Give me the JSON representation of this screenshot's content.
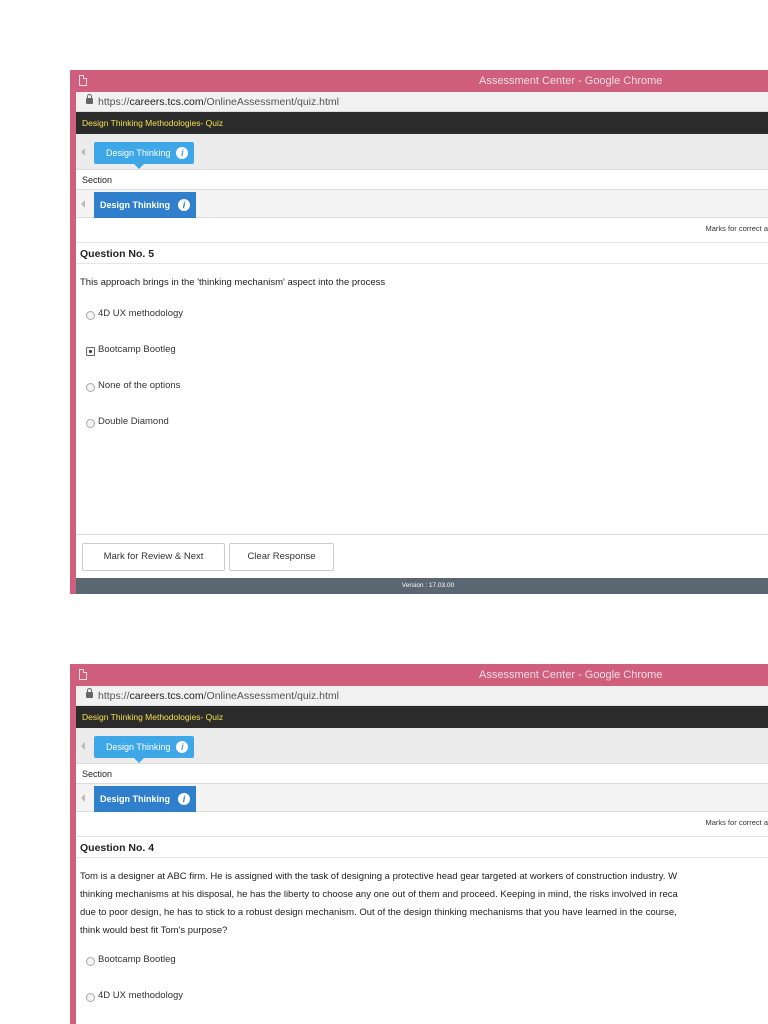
{
  "window": {
    "title": "Assessment Center - Google Chrome"
  },
  "address": {
    "prefix": "https://",
    "host": "careers.tcs.com",
    "path": "/OnlineAssessment/quiz.html"
  },
  "quiz": {
    "title": "Design Thinking Methodologies- Quiz"
  },
  "section": {
    "tab_label": "Design Thinking",
    "label": "Section",
    "sub_tab_label": "Design Thinking"
  },
  "marks_label": "Marks for correct a",
  "screen1": {
    "question_no": "Question No. 5",
    "question_text": "This approach brings in the 'thinking mechanism' aspect into the process",
    "options": [
      {
        "label": "4D UX methodology",
        "selected": false
      },
      {
        "label": "Bootcamp Bootleg",
        "selected": true
      },
      {
        "label": "None of the options",
        "selected": false
      },
      {
        "label": "Double Diamond",
        "selected": false
      }
    ],
    "buttons": {
      "review": "Mark for Review & Next",
      "clear": "Clear Response"
    },
    "version": "Version : 17.03.00"
  },
  "screen2": {
    "question_no": "Question No. 4",
    "question_lines": [
      "Tom is a designer at ABC firm. He is assigned with the task of designing a protective head gear targeted at workers of construction industry. W",
      "thinking mechanisms at his disposal, he has the liberty to choose any one out of them and proceed. Keeping in mind, the risks involved in reca",
      "due to poor design, he has to stick to a robust design mechanism. Out of the design thinking mechanisms that you have learned in the course,",
      "think would best fit Tom's purpose?"
    ],
    "options": [
      {
        "label": "Bootcamp Bootleg",
        "selected": false
      },
      {
        "label": "4D UX methodology",
        "selected": false
      }
    ]
  }
}
